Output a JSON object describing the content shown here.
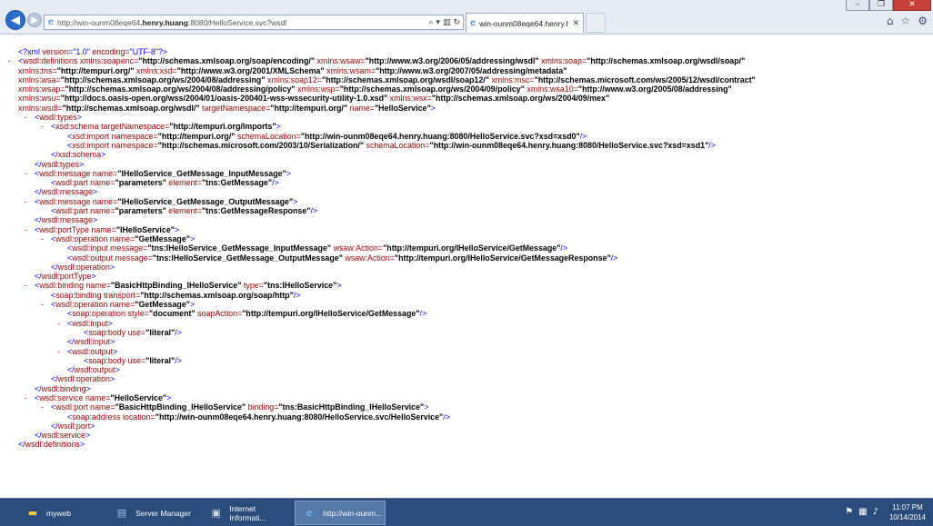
{
  "browser": {
    "url_prefix": "http://win-ounm08eqe64",
    "url_host_bold": ".henry.huang",
    "url_suffix": ":8080/HelloService.svc?wsdl",
    "tab_title": "win-ounm08eqe64.henry.h...",
    "icons": [
      "back-arrow",
      "forward-arrow",
      "ie-page",
      "search",
      "dropdown",
      "compat-view",
      "refresh",
      "close",
      "home",
      "favorites",
      "settings"
    ]
  },
  "xml_colors": {
    "tag": "#990000",
    "bracket": "#0000ff",
    "value": "#000000",
    "toggle": "#d21818"
  },
  "xml_lines": [
    {
      "indent": 0,
      "toggle": false,
      "segs": [
        [
          "pi",
          "<?xml "
        ],
        [
          "piattr",
          "version"
        ],
        [
          "pi",
          "=\""
        ],
        [
          "pi",
          "1.0"
        ],
        [
          "pi",
          "\" "
        ],
        [
          "piattr",
          "encoding"
        ],
        [
          "pi",
          "=\"UTF-8\"?>"
        ]
      ]
    },
    {
      "indent": 0,
      "toggle": true,
      "segs": [
        [
          "br",
          "<"
        ],
        [
          "tag",
          "wsdl:definitions"
        ],
        [
          "an",
          " xmlns:soapenc="
        ],
        [
          "av",
          "\"http://schemas.xmlsoap.org/soap/encoding/\""
        ],
        [
          "an",
          " xmlns:wsaw="
        ],
        [
          "av",
          "\"http://www.w3.org/2006/05/addressing/wsdl\""
        ],
        [
          "an",
          " xmlns:soap="
        ],
        [
          "av",
          "\"http://schemas.xmlsoap.org/wsdl/soap/\""
        ]
      ]
    },
    {
      "indent": 0,
      "toggle": false,
      "segs": [
        [
          "an",
          "xmlns:tns="
        ],
        [
          "av",
          "\"http://tempuri.org/\""
        ],
        [
          "an",
          " xmlns:xsd="
        ],
        [
          "av",
          "\"http://www.w3.org/2001/XMLSchema\""
        ],
        [
          "an",
          " xmlns:wsam="
        ],
        [
          "av",
          "\"http://www.w3.org/2007/05/addressing/metadata\""
        ]
      ]
    },
    {
      "indent": 0,
      "toggle": false,
      "segs": [
        [
          "an",
          "xmlns:wsa="
        ],
        [
          "av",
          "\"http://schemas.xmlsoap.org/ws/2004/08/addressing\""
        ],
        [
          "an",
          " xmlns:soap12="
        ],
        [
          "av",
          "\"http://schemas.xmlsoap.org/wsdl/soap12/\""
        ],
        [
          "an",
          " xmlns:msc="
        ],
        [
          "av",
          "\"http://schemas.microsoft.com/ws/2005/12/wsdl/contract\""
        ]
      ]
    },
    {
      "indent": 0,
      "toggle": false,
      "segs": [
        [
          "an",
          "xmlns:wsap="
        ],
        [
          "av",
          "\"http://schemas.xmlsoap.org/ws/2004/08/addressing/policy\""
        ],
        [
          "an",
          " xmlns:wsp="
        ],
        [
          "av",
          "\"http://schemas.xmlsoap.org/ws/2004/09/policy\""
        ],
        [
          "an",
          " xmlns:wsa10="
        ],
        [
          "av",
          "\"http://www.w3.org/2005/08/addressing\""
        ]
      ]
    },
    {
      "indent": 0,
      "toggle": false,
      "segs": [
        [
          "an",
          "xmlns:wsu="
        ],
        [
          "av",
          "\"http://docs.oasis-open.org/wss/2004/01/oasis-200401-wss-wssecurity-utility-1.0.xsd\""
        ],
        [
          "an",
          " xmlns:wsx="
        ],
        [
          "av",
          "\"http://schemas.xmlsoap.org/ws/2004/09/mex\""
        ]
      ]
    },
    {
      "indent": 0,
      "toggle": false,
      "segs": [
        [
          "an",
          "xmlns:wsdl="
        ],
        [
          "av",
          "\"http://schemas.xmlsoap.org/wsdl/\""
        ],
        [
          "an",
          " targetNamespace="
        ],
        [
          "av",
          "\"http://tempuri.org/\""
        ],
        [
          "an",
          " name="
        ],
        [
          "av",
          "\"HelloService\""
        ],
        [
          "br",
          ">"
        ]
      ]
    },
    {
      "indent": 1,
      "toggle": true,
      "segs": [
        [
          "br",
          "<"
        ],
        [
          "tag",
          "wsdl:types"
        ],
        [
          "br",
          ">"
        ]
      ]
    },
    {
      "indent": 2,
      "toggle": true,
      "segs": [
        [
          "br",
          "<"
        ],
        [
          "tag",
          "xsd:schema"
        ],
        [
          "an",
          " targetNamespace="
        ],
        [
          "av",
          "\"http://tempuri.org/Imports\""
        ],
        [
          "br",
          ">"
        ]
      ]
    },
    {
      "indent": 3,
      "toggle": false,
      "segs": [
        [
          "br",
          "<"
        ],
        [
          "tag",
          "xsd:import"
        ],
        [
          "an",
          " namespace="
        ],
        [
          "av",
          "\"http://tempuri.org/\""
        ],
        [
          "an",
          " schemaLocation="
        ],
        [
          "av",
          "\"http://win-ounm08eqe64.henry.huang:8080/HelloService.svc?xsd=xsd0\""
        ],
        [
          "br",
          "/>"
        ]
      ]
    },
    {
      "indent": 3,
      "toggle": false,
      "segs": [
        [
          "br",
          "<"
        ],
        [
          "tag",
          "xsd:import"
        ],
        [
          "an",
          " namespace="
        ],
        [
          "av",
          "\"http://schemas.microsoft.com/2003/10/Serialization/\""
        ],
        [
          "an",
          " schemaLocation="
        ],
        [
          "av",
          "\"http://win-ounm08eqe64.henry.huang:8080/HelloService.svc?xsd=xsd1\""
        ],
        [
          "br",
          "/>"
        ]
      ]
    },
    {
      "indent": 2,
      "toggle": false,
      "segs": [
        [
          "br",
          "</"
        ],
        [
          "tag",
          "xsd:schema"
        ],
        [
          "br",
          ">"
        ]
      ]
    },
    {
      "indent": 1,
      "toggle": false,
      "segs": [
        [
          "br",
          "</"
        ],
        [
          "tag",
          "wsdl:types"
        ],
        [
          "br",
          ">"
        ]
      ]
    },
    {
      "indent": 1,
      "toggle": true,
      "segs": [
        [
          "br",
          "<"
        ],
        [
          "tag",
          "wsdl:message"
        ],
        [
          "an",
          " name="
        ],
        [
          "av",
          "\"IHelloService_GetMessage_InputMessage\""
        ],
        [
          "br",
          ">"
        ]
      ]
    },
    {
      "indent": 2,
      "toggle": false,
      "segs": [
        [
          "br",
          "<"
        ],
        [
          "tag",
          "wsdl:part"
        ],
        [
          "an",
          " name="
        ],
        [
          "av",
          "\"parameters\""
        ],
        [
          "an",
          " element="
        ],
        [
          "av",
          "\"tns:GetMessage\""
        ],
        [
          "br",
          "/>"
        ]
      ]
    },
    {
      "indent": 1,
      "toggle": false,
      "segs": [
        [
          "br",
          "</"
        ],
        [
          "tag",
          "wsdl:message"
        ],
        [
          "br",
          ">"
        ]
      ]
    },
    {
      "indent": 1,
      "toggle": true,
      "segs": [
        [
          "br",
          "<"
        ],
        [
          "tag",
          "wsdl:message"
        ],
        [
          "an",
          " name="
        ],
        [
          "av",
          "\"IHelloService_GetMessage_OutputMessage\""
        ],
        [
          "br",
          ">"
        ]
      ]
    },
    {
      "indent": 2,
      "toggle": false,
      "segs": [
        [
          "br",
          "<"
        ],
        [
          "tag",
          "wsdl:part"
        ],
        [
          "an",
          " name="
        ],
        [
          "av",
          "\"parameters\""
        ],
        [
          "an",
          " element="
        ],
        [
          "av",
          "\"tns:GetMessageResponse\""
        ],
        [
          "br",
          "/>"
        ]
      ]
    },
    {
      "indent": 1,
      "toggle": false,
      "segs": [
        [
          "br",
          "</"
        ],
        [
          "tag",
          "wsdl:message"
        ],
        [
          "br",
          ">"
        ]
      ]
    },
    {
      "indent": 1,
      "toggle": true,
      "segs": [
        [
          "br",
          "<"
        ],
        [
          "tag",
          "wsdl:portType"
        ],
        [
          "an",
          " name="
        ],
        [
          "av",
          "\"IHelloService\""
        ],
        [
          "br",
          ">"
        ]
      ]
    },
    {
      "indent": 2,
      "toggle": true,
      "segs": [
        [
          "br",
          "<"
        ],
        [
          "tag",
          "wsdl:operation"
        ],
        [
          "an",
          " name="
        ],
        [
          "av",
          "\"GetMessage\""
        ],
        [
          "br",
          ">"
        ]
      ]
    },
    {
      "indent": 3,
      "toggle": false,
      "segs": [
        [
          "br",
          "<"
        ],
        [
          "tag",
          "wsdl:input"
        ],
        [
          "an",
          " message="
        ],
        [
          "av",
          "\"tns:IHelloService_GetMessage_InputMessage\""
        ],
        [
          "an",
          " wsaw:Action="
        ],
        [
          "av",
          "\"http://tempuri.org/IHelloService/GetMessage\""
        ],
        [
          "br",
          "/>"
        ]
      ]
    },
    {
      "indent": 3,
      "toggle": false,
      "segs": [
        [
          "br",
          "<"
        ],
        [
          "tag",
          "wsdl:output"
        ],
        [
          "an",
          " message="
        ],
        [
          "av",
          "\"tns:IHelloService_GetMessage_OutputMessage\""
        ],
        [
          "an",
          " wsaw:Action="
        ],
        [
          "av",
          "\"http://tempuri.org/IHelloService/GetMessageResponse\""
        ],
        [
          "br",
          "/>"
        ]
      ]
    },
    {
      "indent": 2,
      "toggle": false,
      "segs": [
        [
          "br",
          "</"
        ],
        [
          "tag",
          "wsdl:operation"
        ],
        [
          "br",
          ">"
        ]
      ]
    },
    {
      "indent": 1,
      "toggle": false,
      "segs": [
        [
          "br",
          "</"
        ],
        [
          "tag",
          "wsdl:portType"
        ],
        [
          "br",
          ">"
        ]
      ]
    },
    {
      "indent": 1,
      "toggle": true,
      "segs": [
        [
          "br",
          "<"
        ],
        [
          "tag",
          "wsdl:binding"
        ],
        [
          "an",
          " name="
        ],
        [
          "av",
          "\"BasicHttpBinding_IHelloService\""
        ],
        [
          "an",
          " type="
        ],
        [
          "av",
          "\"tns:IHelloService\""
        ],
        [
          "br",
          ">"
        ]
      ]
    },
    {
      "indent": 2,
      "toggle": false,
      "segs": [
        [
          "br",
          "<"
        ],
        [
          "tag",
          "soap:binding"
        ],
        [
          "an",
          " transport="
        ],
        [
          "av",
          "\"http://schemas.xmlsoap.org/soap/http\""
        ],
        [
          "br",
          "/>"
        ]
      ]
    },
    {
      "indent": 2,
      "toggle": true,
      "segs": [
        [
          "br",
          "<"
        ],
        [
          "tag",
          "wsdl:operation"
        ],
        [
          "an",
          " name="
        ],
        [
          "av",
          "\"GetMessage\""
        ],
        [
          "br",
          ">"
        ]
      ]
    },
    {
      "indent": 3,
      "toggle": false,
      "segs": [
        [
          "br",
          "<"
        ],
        [
          "tag",
          "soap:operation"
        ],
        [
          "an",
          " style="
        ],
        [
          "av",
          "\"document\""
        ],
        [
          "an",
          " soapAction="
        ],
        [
          "av",
          "\"http://tempuri.org/IHelloService/GetMessage\""
        ],
        [
          "br",
          "/>"
        ]
      ]
    },
    {
      "indent": 3,
      "toggle": true,
      "segs": [
        [
          "br",
          "<"
        ],
        [
          "tag",
          "wsdl:input"
        ],
        [
          "br",
          ">"
        ]
      ]
    },
    {
      "indent": 4,
      "toggle": false,
      "segs": [
        [
          "br",
          "<"
        ],
        [
          "tag",
          "soap:body"
        ],
        [
          "an",
          " use="
        ],
        [
          "av",
          "\"literal\""
        ],
        [
          "br",
          "/>"
        ]
      ]
    },
    {
      "indent": 3,
      "toggle": false,
      "segs": [
        [
          "br",
          "</"
        ],
        [
          "tag",
          "wsdl:input"
        ],
        [
          "br",
          ">"
        ]
      ]
    },
    {
      "indent": 3,
      "toggle": true,
      "segs": [
        [
          "br",
          "<"
        ],
        [
          "tag",
          "wsdl:output"
        ],
        [
          "br",
          ">"
        ]
      ]
    },
    {
      "indent": 4,
      "toggle": false,
      "segs": [
        [
          "br",
          "<"
        ],
        [
          "tag",
          "soap:body"
        ],
        [
          "an",
          " use="
        ],
        [
          "av",
          "\"literal\""
        ],
        [
          "br",
          "/>"
        ]
      ]
    },
    {
      "indent": 3,
      "toggle": false,
      "segs": [
        [
          "br",
          "</"
        ],
        [
          "tag",
          "wsdl:output"
        ],
        [
          "br",
          ">"
        ]
      ]
    },
    {
      "indent": 2,
      "toggle": false,
      "segs": [
        [
          "br",
          "</"
        ],
        [
          "tag",
          "wsdl:operation"
        ],
        [
          "br",
          ">"
        ]
      ]
    },
    {
      "indent": 1,
      "toggle": false,
      "segs": [
        [
          "br",
          "</"
        ],
        [
          "tag",
          "wsdl:binding"
        ],
        [
          "br",
          ">"
        ]
      ]
    },
    {
      "indent": 1,
      "toggle": true,
      "segs": [
        [
          "br",
          "<"
        ],
        [
          "tag",
          "wsdl:service"
        ],
        [
          "an",
          " name="
        ],
        [
          "av",
          "\"HelloService\""
        ],
        [
          "br",
          ">"
        ]
      ]
    },
    {
      "indent": 2,
      "toggle": true,
      "segs": [
        [
          "br",
          "<"
        ],
        [
          "tag",
          "wsdl:port"
        ],
        [
          "an",
          " name="
        ],
        [
          "av",
          "\"BasicHttpBinding_IHelloService\""
        ],
        [
          "an",
          " binding="
        ],
        [
          "av",
          "\"tns:BasicHttpBinding_IHelloService\""
        ],
        [
          "br",
          ">"
        ]
      ]
    },
    {
      "indent": 3,
      "toggle": false,
      "segs": [
        [
          "br",
          "<"
        ],
        [
          "tag",
          "soap:address"
        ],
        [
          "an",
          " location="
        ],
        [
          "av",
          "\"http://win-ounm08eqe64.henry.huang:8080/HelloService.svc/HelloService\""
        ],
        [
          "br",
          "/>"
        ]
      ]
    },
    {
      "indent": 2,
      "toggle": false,
      "segs": [
        [
          "br",
          "</"
        ],
        [
          "tag",
          "wsdl:port"
        ],
        [
          "br",
          ">"
        ]
      ]
    },
    {
      "indent": 1,
      "toggle": false,
      "segs": [
        [
          "br",
          "</"
        ],
        [
          "tag",
          "wsdl:service"
        ],
        [
          "br",
          ">"
        ]
      ]
    },
    {
      "indent": 0,
      "toggle": false,
      "segs": [
        [
          "br",
          "</"
        ],
        [
          "tag",
          "wsdl:definitions"
        ],
        [
          "br",
          ">"
        ]
      ]
    }
  ],
  "taskbar": {
    "items": [
      {
        "label": "myweb",
        "icon": "folder-icon",
        "active": false
      },
      {
        "label": "Server Manager",
        "icon": "server-manager-icon",
        "active": false
      },
      {
        "label": "Internet Informati...",
        "icon": "iis-icon",
        "active": false
      },
      {
        "label": "http://win-ounm...",
        "icon": "ie-icon",
        "active": true
      }
    ],
    "time": "11:07 PM",
    "date": "10/14/2014"
  }
}
